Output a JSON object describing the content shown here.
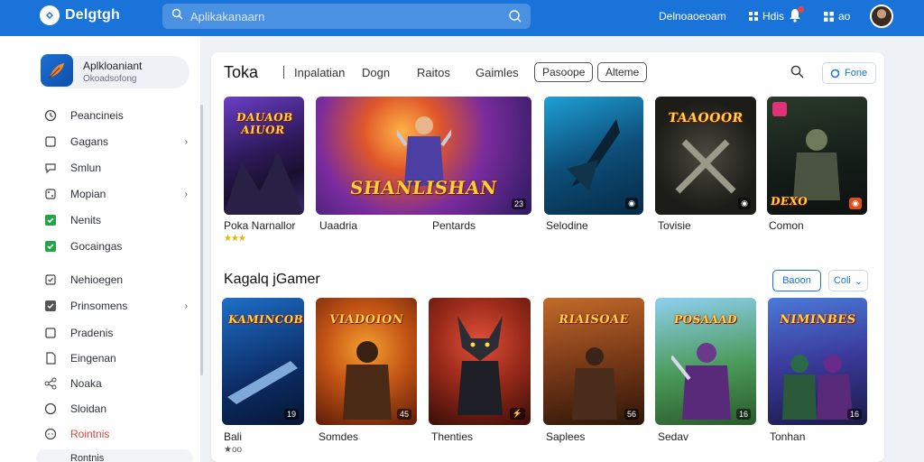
{
  "app": {
    "name": "Delgtgh"
  },
  "search": {
    "placeholder": "Aplikakanaarn"
  },
  "top_links": {
    "account": "Delnoaoeoam",
    "grid": "Hdis",
    "notifications": "ao"
  },
  "colors": {
    "topbar": "#1a73d9",
    "accent": "#1a73d9",
    "active": "#e0453a"
  },
  "profile": {
    "name": "Aplkloaniant",
    "subtitle": "Okoadsofong"
  },
  "sidebar": {
    "items": [
      {
        "label": "Peancineis",
        "icon": "clock-icon"
      },
      {
        "label": "Gagans",
        "icon": "square-icon",
        "has_chevron": true
      },
      {
        "label": "Smlun",
        "icon": "chat-icon"
      },
      {
        "label": "Mopian",
        "icon": "dice-icon",
        "has_chevron": true
      },
      {
        "label": "Nenits",
        "icon": "check-icon",
        "checked": true
      },
      {
        "label": "Gocaingas",
        "icon": "check-icon",
        "checked": true
      },
      {
        "label": "Nehioegen",
        "icon": "check-outline-icon"
      },
      {
        "label": "Prinsomens",
        "icon": "check-box-icon",
        "has_chevron": true
      },
      {
        "label": "Pradenis",
        "icon": "square-icon"
      },
      {
        "label": "Eingenan",
        "icon": "doc-icon"
      },
      {
        "label": "Noaka",
        "icon": "share-icon"
      },
      {
        "label": "Sloidan",
        "icon": "circle-icon"
      },
      {
        "label": "Rointnis",
        "icon": "chat-icon",
        "active": true
      }
    ],
    "bottom_item": "Rontnis"
  },
  "main": {
    "title": "Toka",
    "tabs": [
      "Inpalatian",
      "Dogn",
      "Raitos",
      "Gaimles"
    ],
    "tab_boxes": [
      "Pasoope",
      "Alteme"
    ],
    "tool_button": "Fone",
    "row1": [
      {
        "label": "Poka Narnallor",
        "banner": "DAUAOB AIUOR",
        "rating": "★★★"
      },
      {
        "label": "Uaadria",
        "banner": "SHANLISHAN",
        "badge": "23"
      },
      {
        "label": "Pentards"
      },
      {
        "label": "Selodine",
        "badge": "◉"
      },
      {
        "label": "Tovisie",
        "banner": "TAAOOOR",
        "badge": "◉"
      },
      {
        "label": "Comon",
        "banner": "DEXO",
        "badge": "◉"
      }
    ],
    "section2_title": "Kagalq jGamer",
    "section2_buttons": {
      "primary": "Baoon",
      "secondary": "Coli"
    },
    "row2": [
      {
        "label": "Bali",
        "banner": "KAMINCOBS",
        "badge": "19",
        "sub": "★oo"
      },
      {
        "label": "Somdes",
        "banner": "VIADOION",
        "badge": "45"
      },
      {
        "label": "Thenties",
        "badge": "⚡"
      },
      {
        "label": "Saplees",
        "banner": "RIAISOAE",
        "badge": "56"
      },
      {
        "label": "Sedav",
        "banner": "POSAAAD",
        "badge": "16"
      },
      {
        "label": "Tonhan",
        "banner": "NIMINBES",
        "badge": "16"
      }
    ]
  }
}
